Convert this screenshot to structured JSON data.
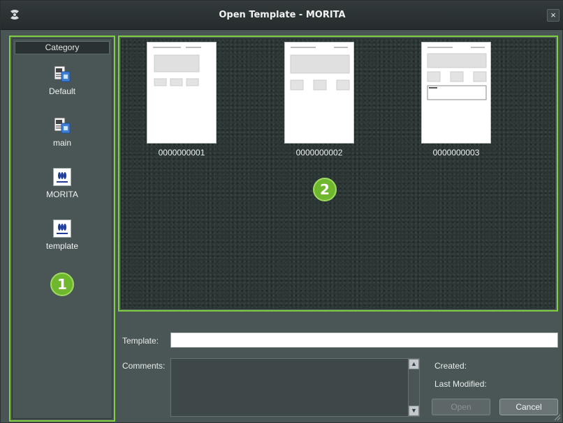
{
  "window": {
    "title": "Open Template - MORITA",
    "close_label": "×"
  },
  "category": {
    "header": "Category",
    "items": [
      {
        "label": "Default",
        "icon": "document-folder-icon"
      },
      {
        "label": "main",
        "icon": "document-folder-icon"
      },
      {
        "label": "MORITA",
        "icon": "morita-logo-icon"
      },
      {
        "label": "template",
        "icon": "morita-logo-icon"
      }
    ]
  },
  "callouts": {
    "one": "1",
    "two": "2"
  },
  "templates": [
    {
      "name": "0000000001"
    },
    {
      "name": "0000000002"
    },
    {
      "name": "0000000003"
    }
  ],
  "form": {
    "template_label": "Template:",
    "template_value": "",
    "comments_label": "Comments:",
    "created_label": "Created:",
    "last_modified_label": "Last Modified:"
  },
  "buttons": {
    "open": "Open",
    "cancel": "Cancel"
  },
  "colors": {
    "highlight": "#7fcf3e",
    "badge": "#6fb82e",
    "background": "#4a5556"
  }
}
